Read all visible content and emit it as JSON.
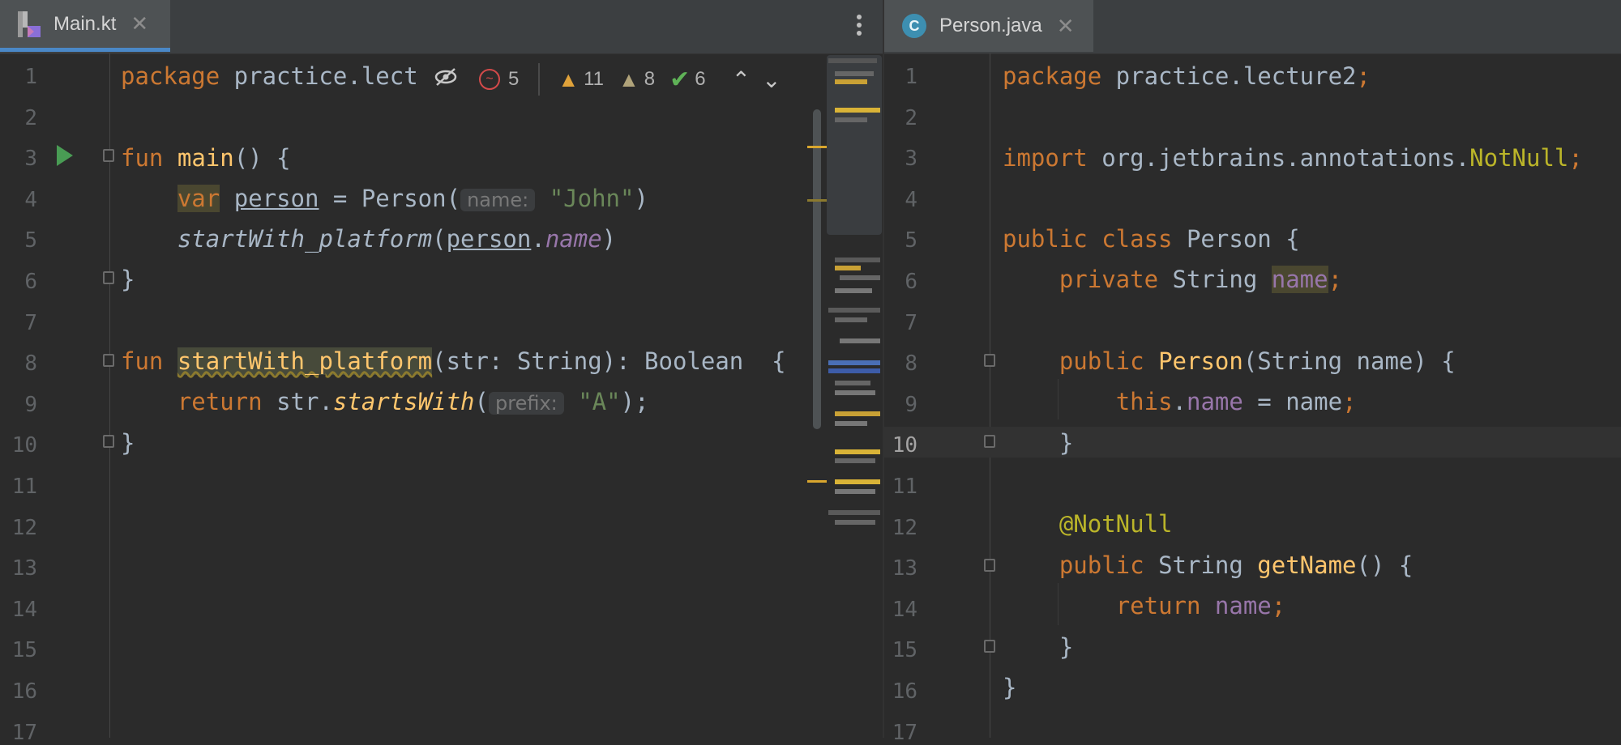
{
  "tabs": {
    "left": {
      "label": "Main.kt",
      "close": "✕",
      "icon": "kotlin-file-icon"
    },
    "right": {
      "label": "Person.java",
      "close": "✕",
      "icon": "java-class-icon",
      "icon_letter": "C"
    }
  },
  "inspection": {
    "errors": "5",
    "warnings": "11",
    "weak_warnings": "8",
    "ok": "6"
  },
  "left_editor": {
    "line_numbers": [
      "1",
      "2",
      "3",
      "4",
      "5",
      "6",
      "7",
      "8",
      "9",
      "10",
      "11",
      "12",
      "13",
      "14",
      "15",
      "16",
      "17"
    ],
    "line1_kw": "package",
    "line1_rest": " practice.lect",
    "line3_kw": "fun",
    "line3_fn": "main",
    "line3_rest": "() {",
    "line4_kw": "var",
    "line4_var": "person",
    "line4_mid": " = Person(",
    "line4_hint": "name:",
    "line4_str": "\"John\"",
    "line4_end": ")",
    "line5_fn": "startWith_platform",
    "line5_open": "(",
    "line5_obj": "person",
    "line5_dot": ".",
    "line5_prop": "name",
    "line5_close": ")",
    "line6": "}",
    "line8_kw": "fun",
    "line8_fn": "startWith_platform",
    "line8_rest": "(str: String): Boolean  {",
    "line9_kw": "return",
    "line9_mid": " str.",
    "line9_fn": "startsWith",
    "line9_open": "(",
    "line9_hint": "prefix:",
    "line9_str": "\"A\"",
    "line9_end": ");",
    "line10": "}"
  },
  "right_editor": {
    "line_numbers": [
      "1",
      "2",
      "3",
      "4",
      "5",
      "6",
      "7",
      "8",
      "9",
      "10",
      "11",
      "12",
      "13",
      "14",
      "15",
      "16",
      "17"
    ],
    "current_line": "10",
    "line1_kw": "package",
    "line1_rest": " practice.lecture2",
    "line1_semi": ";",
    "line3_kw": "import",
    "line3_rest": " org.jetbrains.annotations.",
    "line3_ann": "NotNull",
    "line3_semi": ";",
    "line5_kw": "public class",
    "line5_rest": " Person {",
    "line6_kw": "private",
    "line6_rest": " String ",
    "line6_prop": "name",
    "line6_semi": ";",
    "line8_kw": "public",
    "line8_fn": "Person",
    "line8_rest": "(String name) {",
    "line9_kw": "this",
    "line9_dot": ".",
    "line9_prop": "name",
    "line9_rest": " = name",
    "line9_semi": ";",
    "line10": "}",
    "line12_ann": "@NotNull",
    "line13_kw": "public",
    "line13_mid": " String ",
    "line13_fn": "getName",
    "line13_rest": "() {",
    "line14_kw": "return",
    "line14_prop": "name",
    "line14_semi": ";",
    "line15": "}",
    "line16": "}"
  }
}
